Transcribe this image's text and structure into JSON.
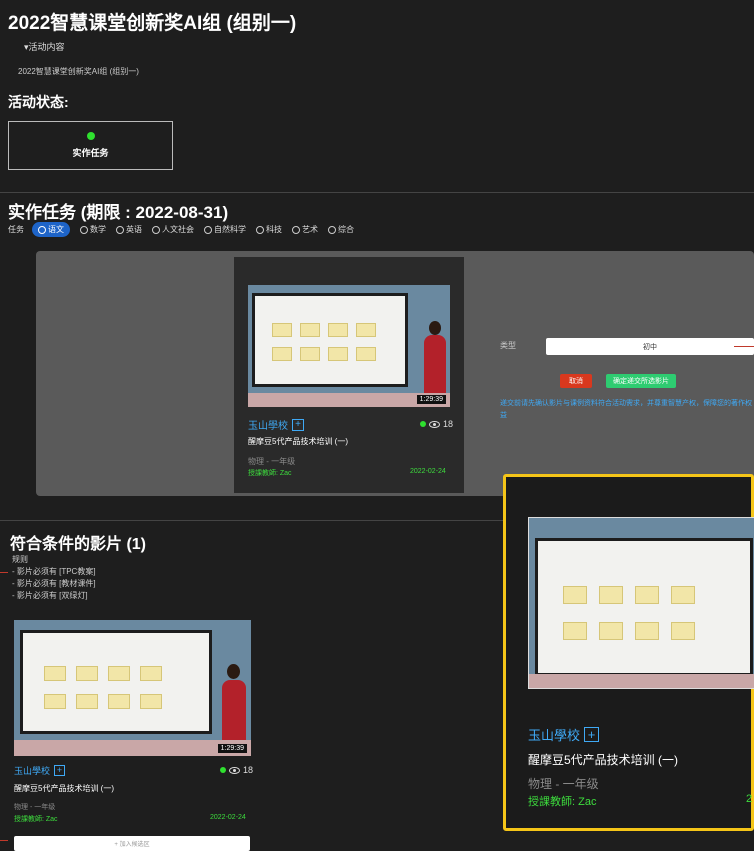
{
  "page": {
    "title": "2022智慧课堂创新奖AI组 (组别一)",
    "activity_toggle": "▾活动内容",
    "activity_desc": "2022智慧课堂创新奖AI组 (组别一)",
    "status_label": "活动状态:",
    "status_value": "实作任务"
  },
  "task": {
    "title": "实作任务 (期限 : 2022-08-31)",
    "filter_label": "任务",
    "subjects": [
      "语文",
      "数学",
      "英语",
      "人文社会",
      "自然科学",
      "科技",
      "艺术",
      "综合"
    ],
    "active_subject": "语文"
  },
  "selected_video": {
    "duration": "1:29:39",
    "school": "玉山學校",
    "views": "18",
    "title": "醒摩豆5代产品技术培训 (一)",
    "subject_grade": "物理 - 一年级",
    "teacher": "授課教師: Zac",
    "date": "2022-02-24"
  },
  "form": {
    "type_label": "类型",
    "type_value": "初中",
    "cancel_label": "取消",
    "confirm_label": "确定递交所选影片",
    "notice": "递交前请先确认影片与课例资料符合活动需求，并尊重智慧产权，保障您的著作权益"
  },
  "matches": {
    "title": "符合条件的影片 (1)",
    "rules_label": "规则",
    "rules": [
      "- 影片必须有 [TPC教案]",
      "- 影片必须有 [教材课件]",
      "- 影片必须有 [双绿灯]"
    ],
    "add_label": "+ 加入候选区"
  },
  "popup": {
    "school": "玉山學校",
    "title": "醒摩豆5代产品技术培训 (一)",
    "subject_grade": "物理 - 一年级",
    "teacher": "授課教師: Zac",
    "date_fragment": "2"
  },
  "colors": {
    "background": "#1e1e1e",
    "active_chip": "#1e64c8",
    "school_link": "#3fa9f5",
    "green": "#3ddc3d",
    "cancel": "#d9381e",
    "confirm": "#2ecc71",
    "highlight": "#f5c518"
  }
}
